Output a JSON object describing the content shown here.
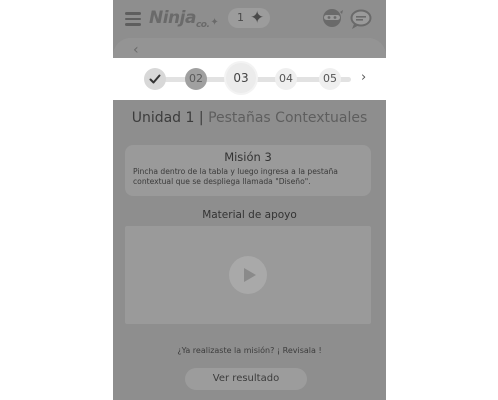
{
  "header": {
    "logo_text": "Ninja",
    "logo_suffix": "co.",
    "stars_count": "1",
    "stars_icon": "sparkle-icon",
    "ninja_icon": "ninja-face-icon",
    "chat_icon": "chat-bubble-icon"
  },
  "stepper": {
    "steps": [
      {
        "label": "",
        "state": "completed",
        "icon": "checkmark-icon"
      },
      {
        "label": "02",
        "state": "visited"
      },
      {
        "label": "03",
        "state": "current"
      },
      {
        "label": "04",
        "state": "upcoming"
      },
      {
        "label": "05",
        "state": "upcoming"
      }
    ],
    "next_icon": "chevron-right-icon"
  },
  "unit": {
    "title": "Unidad 1",
    "separator": "|",
    "subtitle": "Pestañas Contextuales"
  },
  "mission": {
    "title": "Misión 3",
    "text": "Pincha dentro de la tabla y luego ingresa a la pestaña contextual que se despliega llamada \"Diseño\"."
  },
  "material": {
    "label": "Material de apoyo",
    "play_icon": "play-icon"
  },
  "footer": {
    "question": "¿Ya realizaste la misión? ¡ Revisala !",
    "result_button": "Ver resultado"
  },
  "colors": {
    "overlay": "#8e8e8e",
    "stepper_bg": "#ffffff",
    "panel": "#9a9a9a"
  }
}
